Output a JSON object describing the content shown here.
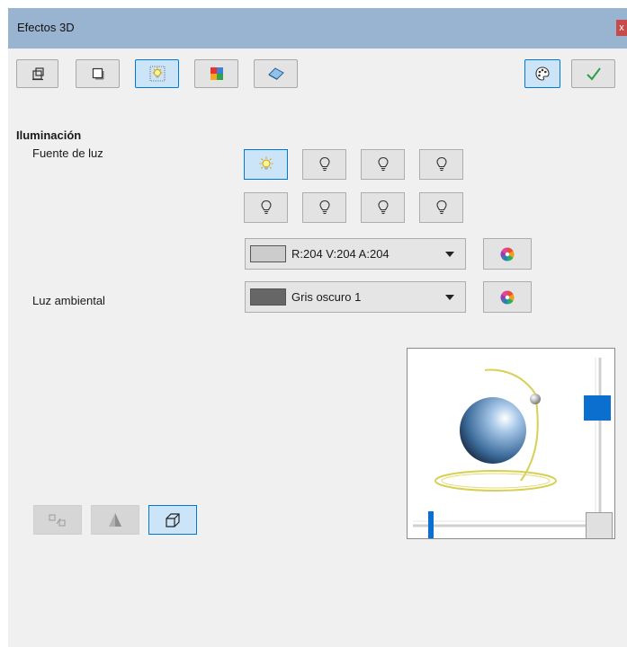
{
  "window": {
    "title": "Efectos 3D",
    "close_glyph": "x"
  },
  "toolbar": {
    "left_icons": [
      "geometry-icon",
      "shading-icon",
      "illumination-icon",
      "textures-icon",
      "material-icon"
    ],
    "right_icons": [
      "favorites-palette-icon",
      "assign-checkmark-icon"
    ],
    "selected": "illumination-icon"
  },
  "illumination": {
    "section_title": "Iluminación",
    "light_source_label": "Fuente de luz",
    "ambient_light_label": "Luz ambiental",
    "light_buttons_active_index": 0,
    "light_color": {
      "text": "R:204 V:204 A:204",
      "swatch": "#cccccc"
    },
    "ambient_color": {
      "text": "Gris oscuro 1",
      "swatch": "#666666"
    }
  },
  "bottom_buttons": {
    "icons": [
      "convert-to-3d-icon",
      "convert-to-lathe-icon",
      "perspective-icon"
    ],
    "selected": "perspective-icon"
  },
  "colors": {
    "titlebar": "#99b4d1",
    "accent": "#0078d7",
    "selected_bg": "#cce4f7",
    "slider_handle": "#0a6fcf"
  }
}
